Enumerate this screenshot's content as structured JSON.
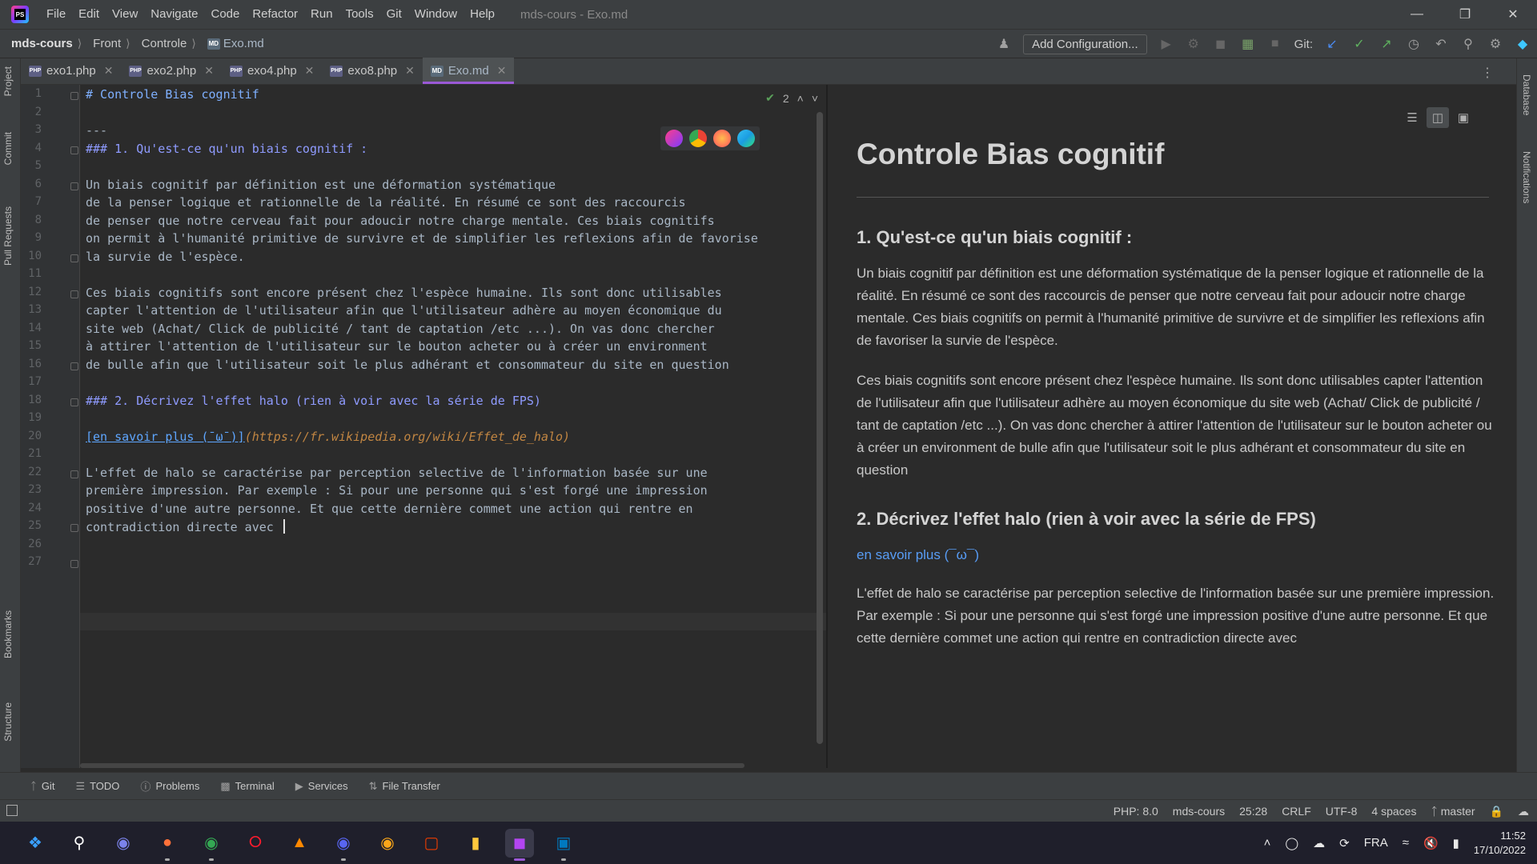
{
  "app": {
    "window_title": "mds-cours - Exo.md",
    "menu": [
      "File",
      "Edit",
      "View",
      "Navigate",
      "Code",
      "Refactor",
      "Run",
      "Tools",
      "Git",
      "Window",
      "Help"
    ]
  },
  "nav": {
    "project": "mds-cours",
    "crumbs": [
      "Front",
      "Controle"
    ],
    "file": "Exo.md",
    "add_configuration": "Add Configuration...",
    "git_label": "Git:"
  },
  "side_tools": {
    "left": [
      "Project",
      "Commit",
      "Pull Requests",
      "Bookmarks",
      "Structure"
    ],
    "right": [
      "Database",
      "Notifications"
    ]
  },
  "tabs": [
    {
      "label": "exo1.php",
      "icon": "php-file-icon"
    },
    {
      "label": "exo2.php",
      "icon": "php-file-icon"
    },
    {
      "label": "exo4.php",
      "icon": "php-file-icon"
    },
    {
      "label": "exo8.php",
      "icon": "php-file-icon"
    },
    {
      "label": "Exo.md",
      "icon": "md-file-icon",
      "active": true
    }
  ],
  "editor": {
    "inspection_count": "2",
    "line_numbers": [
      "1",
      "2",
      "3",
      "4",
      "5",
      "6",
      "7",
      "8",
      "9",
      "10",
      "11",
      "12",
      "13",
      "14",
      "15",
      "16",
      "17",
      "18",
      "19",
      "20",
      "21",
      "22",
      "23",
      "24",
      "25",
      "26",
      "27"
    ],
    "lines": [
      "# Controle Bias cognitif",
      "",
      "---",
      "### 1. Qu'est-ce qu'un biais cognitif :",
      "",
      "Un biais cognitif par définition est une déformation systématique",
      "de la penser logique et rationnelle de la réalité. En résumé ce sont des raccourcis",
      "de penser que notre cerveau fait pour adoucir notre charge mentale. Ces biais cognitifs",
      "on permit à l'humanité primitive de survivre et de simplifier les reflexions afin de favorise",
      "la survie de l'espèce.",
      "",
      "Ces biais cognitifs sont encore présent chez l'espèce humaine. Ils sont donc utilisables",
      "capter l'attention de l'utilisateur afin que l'utilisateur adhère au moyen économique du",
      "site web (Achat/ Click de publicité / tant de captation /etc ...). On vas donc chercher",
      "à attirer l'attention de l'utilisateur sur le bouton acheter ou à créer un environment",
      "de bulle afin que l'utilisateur soit le plus adhérant et consommateur du site en question",
      "",
      "### 2. Décrivez l'effet halo (rien à voir avec la série de FPS)",
      "",
      "[en savoir plus (¯ω¯)](https://fr.wikipedia.org/wiki/Effet_de_halo)",
      "",
      "L'effet de halo se caractérise par perception selective de l'information basée sur une",
      "première impression. Par exemple : Si pour une personne qui s'est forgé une impression",
      "positive d'une autre personne. Et que cette dernière commet une action qui rentre en",
      "contradiction directe avec ",
      "",
      ""
    ],
    "line20_link_text": "[en savoir plus (¯ω¯)]",
    "line20_url": "(https://fr.wikipedia.org/wiki/Effet_de_halo)"
  },
  "preview": {
    "h1": "Controle Bias cognitif",
    "h3_1": "1. Qu'est-ce qu'un biais cognitif :",
    "p1": "Un biais cognitif par définition est une déformation systématique de la penser logique et rationnelle de la réalité. En résumé ce sont des raccourcis de penser que notre cerveau fait pour adoucir notre charge mentale. Ces biais cognitifs on permit à l'humanité primitive de survivre et de simplifier les reflexions afin de favoriser la survie de l'espèce.",
    "p2": "Ces biais cognitifs sont encore présent chez l'espèce humaine. Ils sont donc utilisables capter l'attention de l'utilisateur afin que l'utilisateur adhère au moyen économique du site web (Achat/ Click de publicité / tant de captation /etc ...). On vas donc chercher à attirer l'attention de l'utilisateur sur le bouton acheter ou à créer un environment de bulle afin que l'utilisateur soit le plus adhérant et consommateur du site en question",
    "h3_2": "2. Décrivez l'effet halo (rien à voir avec la série de FPS)",
    "link": "en savoir plus (¯ω¯)",
    "p3": "L'effet de halo se caractérise par perception selective de l'information basée sur une première impression. Par exemple : Si pour une personne qui s'est forgé une impression positive d'une autre personne. Et que cette dernière commet une action qui rentre en contradiction directe avec"
  },
  "tool_windows": [
    "Git",
    "TODO",
    "Problems",
    "Terminal",
    "Services",
    "File Transfer"
  ],
  "status": {
    "php": "PHP: 8.0",
    "project": "mds-cours",
    "position": "25:28",
    "line_sep": "CRLF",
    "encoding": "UTF-8",
    "indent": "4 spaces",
    "branch": "master"
  },
  "taskbar": {
    "lang": "FRA",
    "time": "11:52",
    "date": "17/10/2022",
    "apps": [
      "windows-start-icon",
      "search-icon",
      "teams-icon",
      "firefox-icon",
      "chrome-icon",
      "opera-icon",
      "vlc-icon",
      "discord-icon",
      "discord-ptb-icon",
      "office-icon",
      "file-explorer-icon",
      "phpstorm-icon",
      "trello-icon"
    ]
  },
  "colors": {
    "accent": "#9b59d6",
    "link": "#589df6",
    "editor_bg": "#2b2b2b"
  }
}
